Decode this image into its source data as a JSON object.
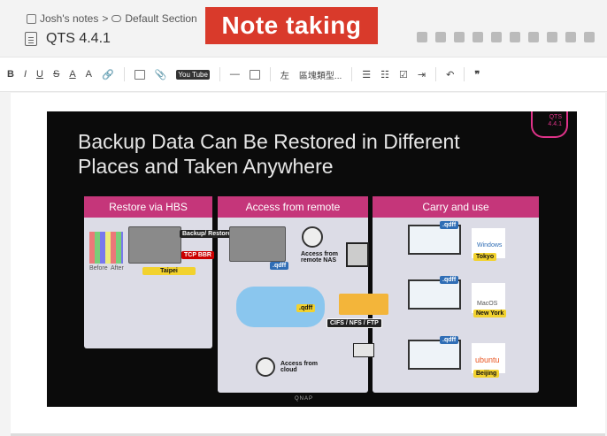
{
  "breadcrumb": {
    "notebook": "Josh's notes",
    "separator": ">",
    "section": "Default Section"
  },
  "note": {
    "title": "QTS 4.4.1"
  },
  "banner": {
    "text": "Note taking"
  },
  "toolbar": {
    "bold": "B",
    "italic": "I",
    "underline": "U",
    "strike": "S",
    "font_color": "A",
    "highlight": "A",
    "youtube": "You Tube",
    "hr": "—",
    "align_label": "左",
    "block_label": "區塊類型...",
    "quote": "❞"
  },
  "slide": {
    "title_line1": "Backup Data Can Be Restored in Different",
    "title_line2": "Places and Taken Anywhere",
    "qts_badge_line1": "QTS",
    "qts_badge_line2": "4.4.1",
    "panels": [
      "Restore via HBS",
      "Access from remote",
      "Carry and use"
    ],
    "backup_restore": "Backup/ Restore",
    "tcp_bbr": "TCP BBR",
    "taipei": "Taipei",
    "before": "Before",
    "after": "After",
    "qdff": ".qdff",
    "access_remote_nas": "Access from remote NAS",
    "access_cloud": "Access from cloud",
    "cifs": "CIFS / NFS / FTP",
    "windows": "Windows",
    "tokyo": "Tokyo",
    "macos": "MacOS",
    "new_york": "New York",
    "ubuntu": "ubuntu",
    "beijing": "Beijing",
    "qnap": "QNAP"
  },
  "colors": {
    "banner": "#d93a2b",
    "panel_header": "#c5367a",
    "slide_bg": "#0b0b0b"
  }
}
